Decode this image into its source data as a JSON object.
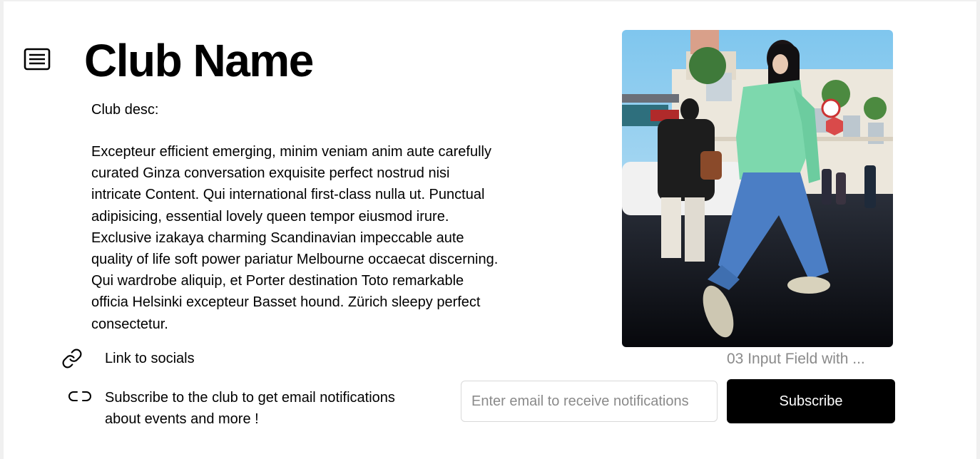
{
  "header": {
    "menu_icon": "menu-lines-icon",
    "title": "Club Name"
  },
  "description": {
    "label": "Club desc:",
    "lines": [
      "Excepteur efficient emerging, minim veniam anim aute carefully",
      "curated Ginza conversation exquisite perfect nostrud nisi",
      "intricate Content. Qui  international first-class nulla ut. Punctual",
      "adipisicing, essential lovely queen tempor eiusmod irure.",
      "Exclusive izakaya charming Scandinavian impeccable aute",
      "quality of life soft power pariatur Melbourne occaecat discerning.",
      "Qui wardrobe aliquip, et Porter destination Toto remarkable",
      "officia Helsinki excepteur Basset hound. Zürich sleepy perfect",
      "consectetur."
    ]
  },
  "socials": {
    "icon": "link-icon",
    "label": "Link to socials"
  },
  "subscribe": {
    "icon": "link-broken-icon",
    "text_lines": [
      "Subscribe to the club to get email notifications",
      "about events and more !"
    ],
    "email_placeholder": "Enter email to receive notifications",
    "button_label": "Subscribe"
  },
  "photo": {
    "caption": "03 Input Field with ..."
  }
}
